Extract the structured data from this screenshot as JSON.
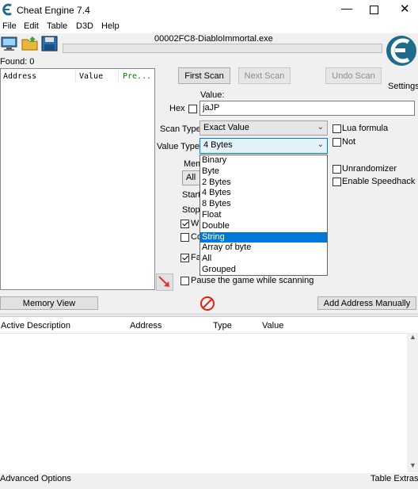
{
  "window": {
    "title": "Cheat Engine 7.4"
  },
  "menu": [
    "File",
    "Edit",
    "Table",
    "D3D",
    "Help"
  ],
  "process_name": "00002FC8-DiabloImmortal.exe",
  "found": "Found: 0",
  "results_columns": {
    "address": "Address",
    "value": "Value",
    "previous": "Pre..."
  },
  "buttons": {
    "first_scan": "First Scan",
    "next_scan": "Next Scan",
    "undo_scan": "Undo Scan",
    "memory_view": "Memory View",
    "add_address": "Add Address Manually"
  },
  "settings_label": "Settings",
  "value_label": "Value:",
  "hex_label": "Hex",
  "value_input": "jaJP",
  "scan_type": {
    "label": "Scan Type",
    "selected": "Exact Value"
  },
  "value_type": {
    "label": "Value Type",
    "selected": "4 Bytes",
    "options": [
      "Binary",
      "Byte",
      "2 Bytes",
      "4 Bytes",
      "8 Bytes",
      "Float",
      "Double",
      "String",
      "Array of byte",
      "All",
      "Grouped"
    ],
    "highlighted": "String"
  },
  "options_right": {
    "lua_formula": "Lua formula",
    "not": "Not",
    "unrandomizer": "Unrandomizer",
    "speedhack": "Enable Speedhack"
  },
  "partial_labels": {
    "mem": "Mem",
    "all": "All",
    "start": "Start",
    "stop": "Stop",
    "wi": "Wi",
    "co": "Co",
    "fa": "Fa"
  },
  "pause_label": "Pause the game while scanning",
  "address_list_columns": {
    "active": "Active",
    "description": "Description",
    "address": "Address",
    "type": "Type",
    "value": "Value"
  },
  "footer": {
    "advanced": "Advanced Options",
    "extras": "Table Extras"
  }
}
